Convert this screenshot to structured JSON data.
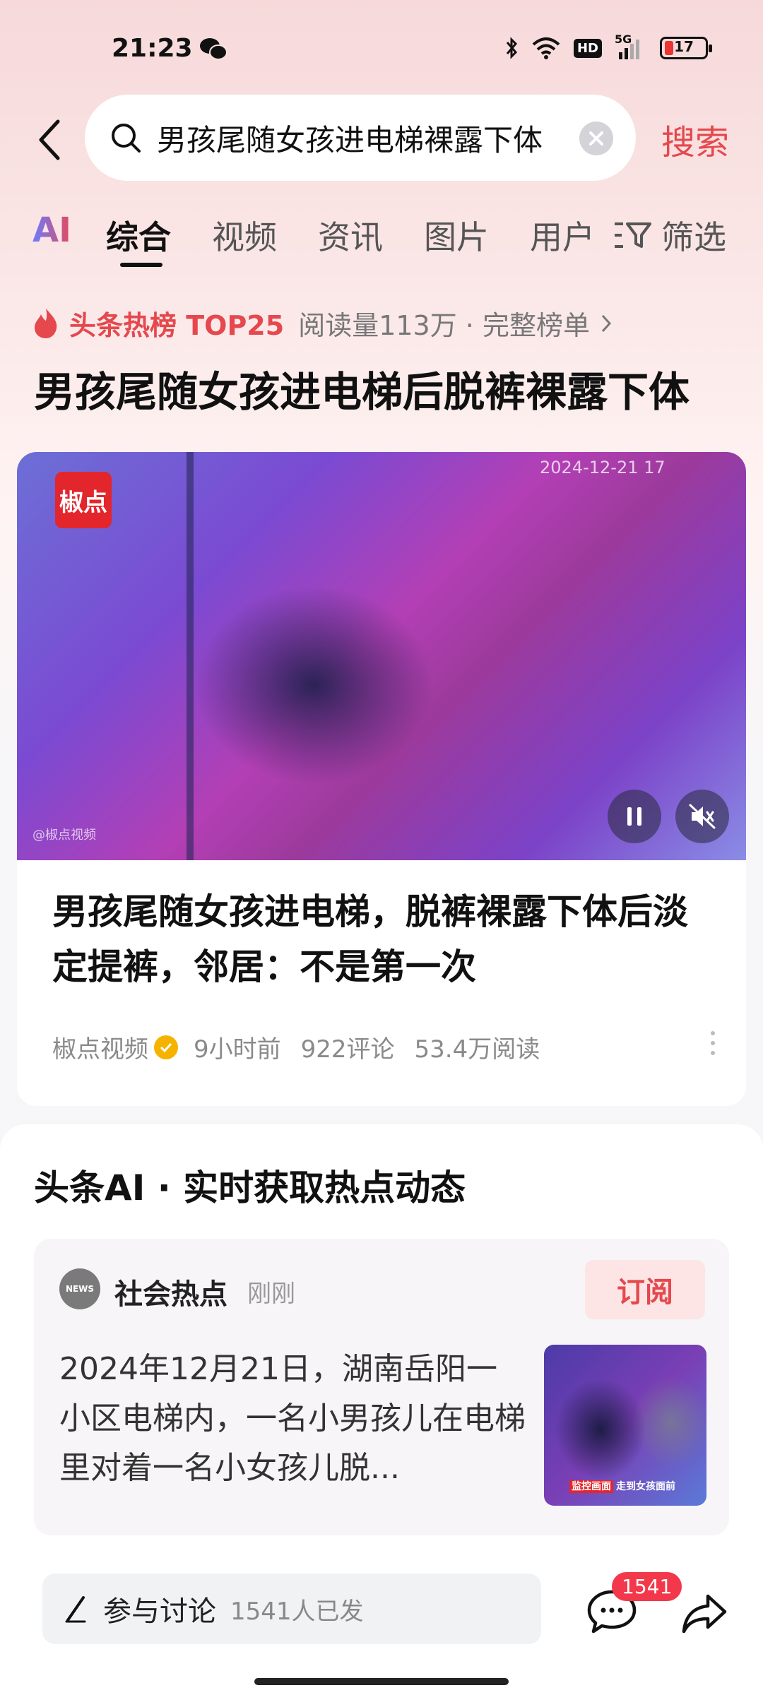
{
  "status_bar": {
    "time": "21:23",
    "network": "5G",
    "hd": "HD",
    "battery": "17"
  },
  "search": {
    "query": "男孩尾随女孩进电梯裸露下体",
    "submit_label": "搜索"
  },
  "tabs": {
    "ai": "AI",
    "items": [
      {
        "label": "综合"
      },
      {
        "label": "视频"
      },
      {
        "label": "资讯"
      },
      {
        "label": "图片"
      },
      {
        "label": "用户"
      }
    ],
    "filter_label": "筛选"
  },
  "hot_list": {
    "label": "头条热榜 TOP25",
    "meta": "阅读量113万 · 完整榜单",
    "title": "男孩尾随女孩进电梯后脱裤裸露下体"
  },
  "video_card": {
    "logo_text": "椒点",
    "timestamp_overlay": "2024-12-21 17",
    "watermark": "@椒点视频",
    "title": "男孩尾随女孩进电梯，脱裤裸露下体后淡定提裤，邻居：不是第一次",
    "source": "椒点视频",
    "time_ago": "9小时前",
    "comments": "922评论",
    "reads": "53.4万阅读"
  },
  "ai_section": {
    "heading": "头条AI · 实时获取热点动态",
    "avatar_text": "NEWS",
    "channel_name": "社会热点",
    "channel_time": "刚刚",
    "subscribe_label": "订阅",
    "summary": "2024年12月21日，湖南岳阳一小区电梯内，一名小男孩儿在电梯里对着一名小女孩儿脱...",
    "thumb_caption_tag": "监控画面",
    "thumb_caption": "走到女孩面前"
  },
  "bottom_bar": {
    "discuss_label": "参与讨论",
    "discuss_count": "1541人已发",
    "comment_badge": "1541"
  },
  "colors": {
    "accent": "#e5484d",
    "badge": "#f2384a"
  }
}
